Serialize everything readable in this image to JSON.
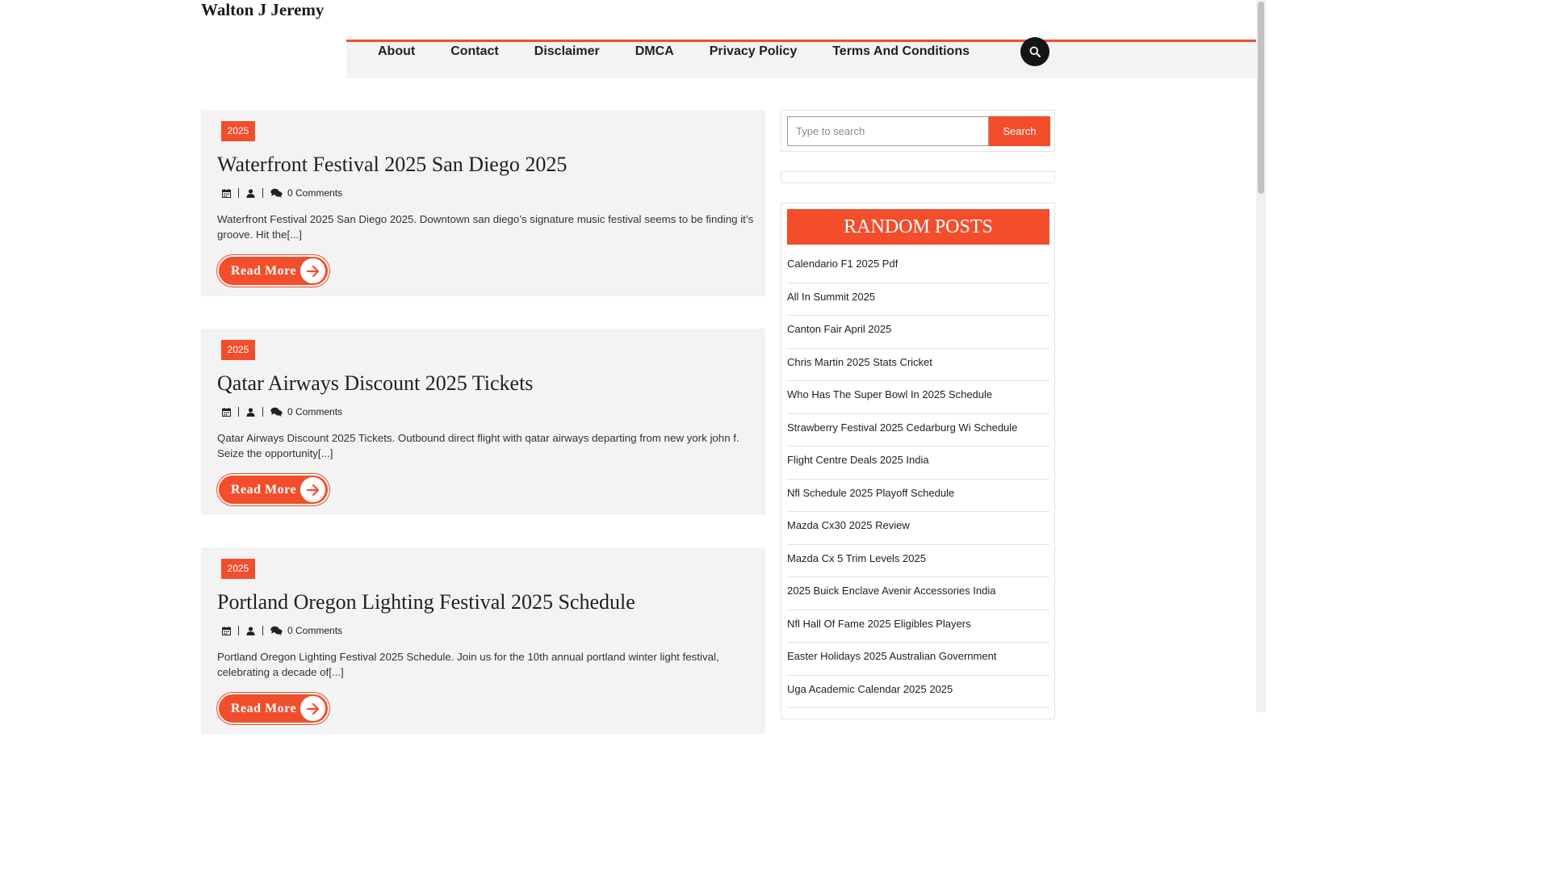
{
  "site": {
    "title": "Walton J Jeremy"
  },
  "nav": {
    "items": [
      "About",
      "Contact",
      "Disclaimer",
      "DMCA",
      "Privacy Policy",
      "Terms And Conditions"
    ]
  },
  "posts": [
    {
      "category": "2025",
      "title": "Waterfront Festival 2025 San Diego 2025",
      "comments": "0 Comments",
      "excerpt": "Waterfront Festival 2025 San Diego 2025. Downtown san diego’s signature music festival seems to be finding it’s groove. Hit the[...]",
      "read_more": "Read More"
    },
    {
      "category": "2025",
      "title": "Qatar Airways Discount 2025 Tickets",
      "comments": "0 Comments",
      "excerpt": "Qatar Airways Discount 2025 Tickets. Outbound direct flight with qatar airways departing from new york john f. Seize the opportunity[...]",
      "read_more": "Read More"
    },
    {
      "category": "2025",
      "title": "Portland Oregon Lighting Festival 2025 Schedule",
      "comments": "0 Comments",
      "excerpt": "Portland Oregon Lighting Festival 2025 Schedule. Join us for the 10th annual portland winter light festival, celebrating a decade of[...]",
      "read_more": "Read More"
    }
  ],
  "sidebar": {
    "search": {
      "placeholder": "Type to search",
      "button": "Search"
    },
    "random_posts": {
      "title": "RANDOM POSTS",
      "items": [
        "Calendario F1 2025 Pdf",
        "All In Summit 2025",
        "Canton Fair April 2025",
        "Chris Martin 2025 Stats Cricket",
        "Who Has The Super Bowl In 2025 Schedule",
        "Strawberry Festival 2025 Cedarburg Wi Schedule",
        "Flight Centre Deals 2025 India",
        "Nfl Schedule 2025 Playoff Schedule",
        "Mazda Cx30 2025 Review",
        "Mazda Cx 5 Trim Levels 2025",
        "2025 Buick Enclave Avenir Accessories India",
        "Nfl Hall Of Fame 2025 Eligibles Players",
        "Easter Holidays 2025 Australian Government",
        "Uga Academic Calendar 2025 2025"
      ]
    }
  },
  "colors": {
    "accent": "#f24e2c",
    "panel": "#f3f3f3",
    "dark": "#151515"
  },
  "icons": [
    "search-icon",
    "calendar-icon",
    "user-icon",
    "comments-icon",
    "arrow-right-icon"
  ]
}
